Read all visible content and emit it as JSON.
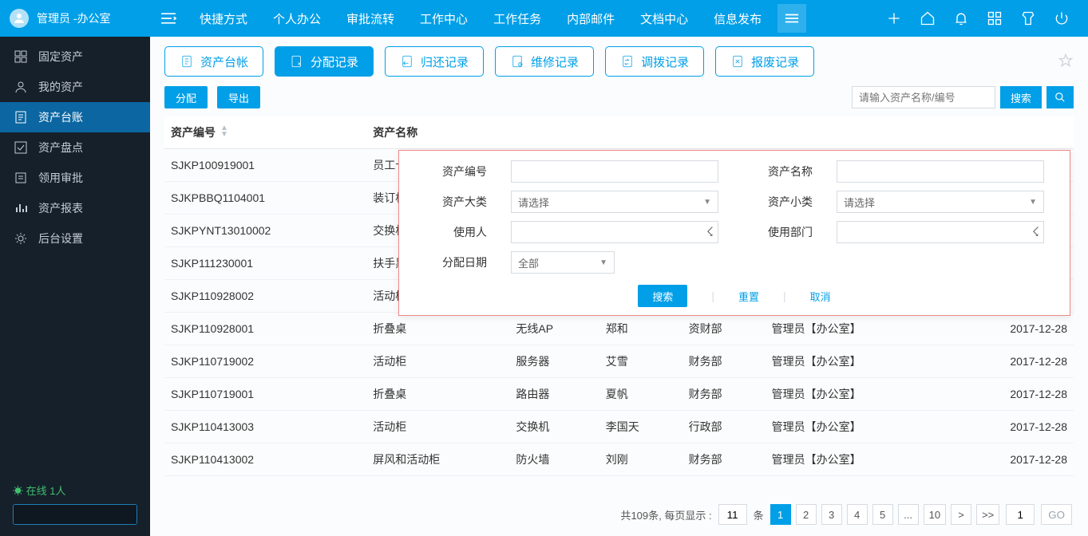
{
  "user": {
    "name": "管理员",
    "dept": "办公室"
  },
  "topnav": {
    "items": [
      "快捷方式",
      "个人办公",
      "审批流转",
      "工作中心",
      "工作任务",
      "内部邮件",
      "文档中心",
      "信息发布"
    ]
  },
  "sidebar": {
    "items": [
      {
        "label": "固定资产",
        "icon": "module"
      },
      {
        "label": "我的资产",
        "icon": "user"
      },
      {
        "label": "资产台账",
        "icon": "ledger",
        "active": true
      },
      {
        "label": "资产盘点",
        "icon": "check"
      },
      {
        "label": "领用审批",
        "icon": "approve"
      },
      {
        "label": "资产报表",
        "icon": "report"
      },
      {
        "label": "后台设置",
        "icon": "gear"
      }
    ],
    "online_label": "在线 1人"
  },
  "tabs": {
    "items": [
      "资产台帐",
      "分配记录",
      "归还记录",
      "维修记录",
      "调拨记录",
      "报废记录"
    ],
    "active_index": 1
  },
  "actions": {
    "btn_allocate": "分配",
    "btn_export": "导出",
    "search_placeholder": "请输入资产名称/编号",
    "btn_search": "搜索"
  },
  "table": {
    "columns": [
      "资产编号",
      "资产名称",
      "",
      "",
      "",
      "",
      "",
      ""
    ],
    "rows": [
      {
        "no": "SJKP100919001",
        "name": "员工卡座",
        "c3": "",
        "c4": "",
        "c5": "",
        "c6": "",
        "c7": ""
      },
      {
        "no": "SJKPBBQ1104001",
        "name": "装订机",
        "c3": "",
        "c4": "",
        "c5": "",
        "c6": "",
        "c7": ""
      },
      {
        "no": "SJKPYNT13010002",
        "name": "交换机",
        "c3": "",
        "c4": "",
        "c5": "",
        "c6": "",
        "c7": ""
      },
      {
        "no": "SJKP111230001",
        "name": "扶手黑沙发",
        "c3": "",
        "c4": "",
        "c5": "",
        "c6": "",
        "c7": ""
      },
      {
        "no": "SJKP110928002",
        "name": "活动柜",
        "c3": "",
        "c4": "",
        "c5": "",
        "c6": "",
        "c7": ""
      },
      {
        "no": "SJKP110928001",
        "name": "折叠桌",
        "c3": "无线AP",
        "c4": "郑和",
        "c5": "资财部",
        "c6": "管理员【办公室】",
        "c7": "2017-12-28"
      },
      {
        "no": "SJKP110719002",
        "name": "活动柜",
        "c3": "服务器",
        "c4": "艾雪",
        "c5": "财务部",
        "c6": "管理员【办公室】",
        "c7": "2017-12-28"
      },
      {
        "no": "SJKP110719001",
        "name": "折叠桌",
        "c3": "路由器",
        "c4": "夏帆",
        "c5": "财务部",
        "c6": "管理员【办公室】",
        "c7": "2017-12-28"
      },
      {
        "no": "SJKP110413003",
        "name": "活动柜",
        "c3": "交换机",
        "c4": "李国天",
        "c5": "行政部",
        "c6": "管理员【办公室】",
        "c7": "2017-12-28"
      },
      {
        "no": "SJKP110413002",
        "name": "屏风和活动柜",
        "c3": "防火墙",
        "c4": "刘刚",
        "c5": "财务部",
        "c6": "管理员【办公室】",
        "c7": "2017-12-28"
      }
    ]
  },
  "pagination": {
    "summary_prefix": "共",
    "total": "109",
    "summary_mid": "条, 每页显示 :",
    "per_page_value": "11",
    "per_page_suffix": "条",
    "pages": [
      "1",
      "2",
      "3",
      "4",
      "5",
      "...",
      "10",
      ">",
      ">>"
    ],
    "active_page": "1",
    "go_value": "1",
    "go_label": "GO"
  },
  "adv": {
    "labels": {
      "asset_no": "资产编号",
      "asset_name": "资产名称",
      "cat_big": "资产大类",
      "cat_small": "资产小类",
      "user": "使用人",
      "dept": "使用部门",
      "alloc_date": "分配日期"
    },
    "placeholders": {
      "select": "请选择",
      "date_all": "全部"
    },
    "buttons": {
      "search": "搜索",
      "reset": "重置",
      "cancel": "取消"
    }
  }
}
